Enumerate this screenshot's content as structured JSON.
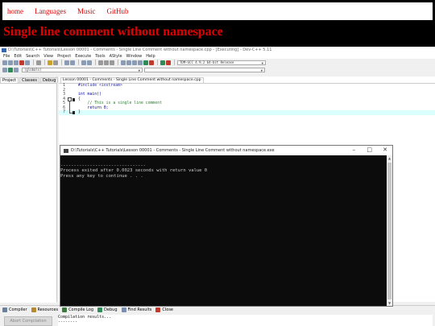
{
  "nav": {
    "items": [
      "home",
      "Languages",
      "Music",
      "GitHub"
    ]
  },
  "headline": "Single line comment without namespace",
  "ide": {
    "title": "D:\\Tutorials\\C++ Tutorials\\Lesson 00001 - Comments - Single Line Comment without namespace.cpp - [Executing] - Dev-C++ 5.11",
    "menu": [
      "File",
      "Edit",
      "Search",
      "View",
      "Project",
      "Execute",
      "Tools",
      "AStyle",
      "Window",
      "Help"
    ],
    "compiler_select": "TDM-GCC 4.9.2 64-bit Release",
    "scope_select": "(globals)",
    "left_tabs": [
      "Project",
      "Classes",
      "Debug"
    ],
    "editor_tab": "Lesson 00001 - Comments - Single Line Comment without namespace.cpp",
    "code": [
      {
        "num": "1",
        "text": "#include <iostream>"
      },
      {
        "num": "2",
        "text": ""
      },
      {
        "num": "3",
        "text": "int main()"
      },
      {
        "num": "4",
        "text": "{"
      },
      {
        "num": "5",
        "text": "    // This is a single line comment"
      },
      {
        "num": "6",
        "text": "    return 0;"
      },
      {
        "num": "7",
        "text": "}"
      }
    ],
    "bottom_tabs": [
      "Compiler",
      "Resources",
      "Compile Log",
      "Debug",
      "Find Results",
      "Close"
    ],
    "abort_label": "Abort Compilation",
    "compile_log": "Compilation results...\n--------"
  },
  "console": {
    "title": "D:\\Tutorials\\C++ Tutorials\\Lesson 00001 - Comments - Single Line Comment without namespace.exe",
    "output": "\n--------------------------------\nProcess exited after 0.0023 seconds with return value 0\nPress any key to continue . . ."
  },
  "colors": {
    "accent": "#e00000",
    "console_bg": "#0c0c0c",
    "line_highlight": "#d9ffff"
  }
}
